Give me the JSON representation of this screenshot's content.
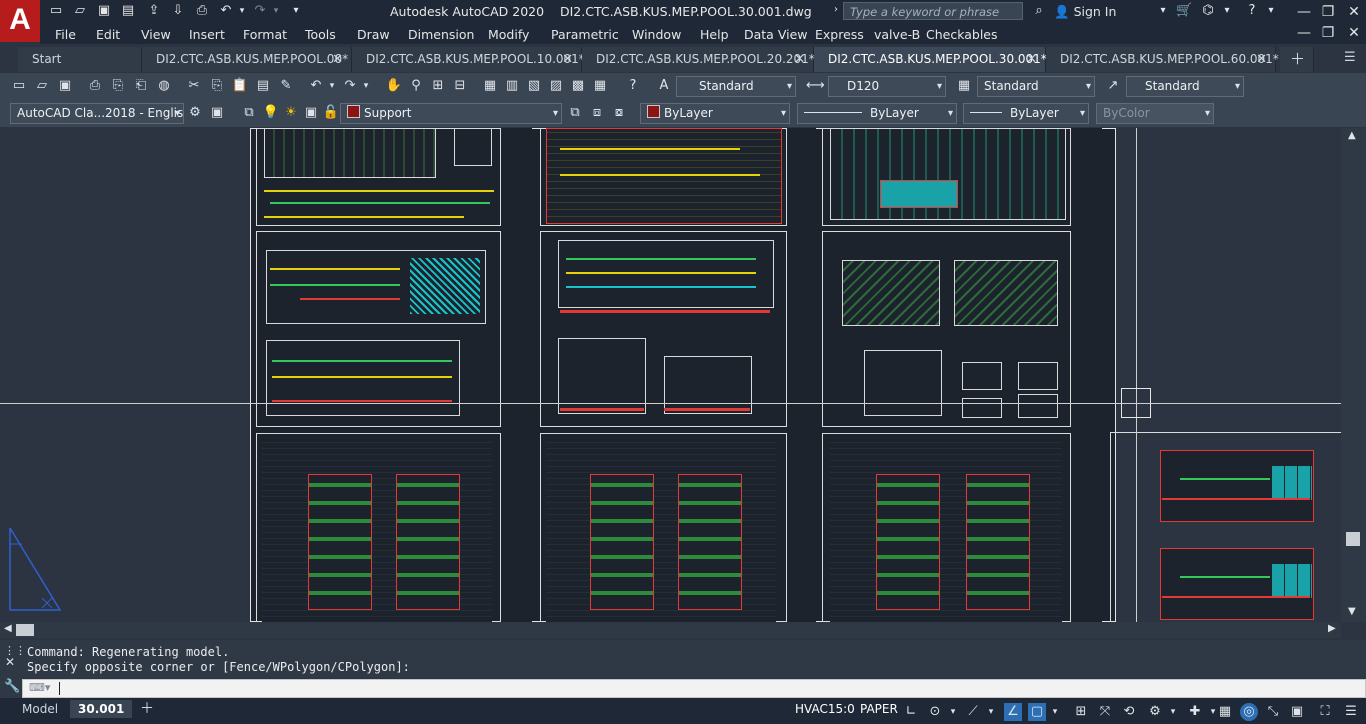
{
  "app": {
    "logo_letter": "A",
    "title": "Autodesk AutoCAD 2020",
    "filename": "DI2.CTC.ASB.KUS.MEP.POOL.30.001.dwg",
    "search_placeholder": "Type a keyword or phrase",
    "sign_in": "Sign In"
  },
  "menu": [
    "File",
    "Edit",
    "View",
    "Insert",
    "Format",
    "Tools",
    "Draw",
    "Dimension",
    "Modify",
    "Parametric",
    "Window",
    "Help",
    "Data View",
    "Express",
    "valve-B",
    "Checkables"
  ],
  "tabs": [
    {
      "label": "Start",
      "active": false
    },
    {
      "label": "DI2.CTC.ASB.KUS.MEP.POOL.00*",
      "active": false
    },
    {
      "label": "DI2.CTC.ASB.KUS.MEP.POOL.10.001*",
      "active": false
    },
    {
      "label": "DI2.CTC.ASB.KUS.MEP.POOL.20.201*",
      "active": false
    },
    {
      "label": "DI2.CTC.ASB.KUS.MEP.POOL.30.001*",
      "active": true
    },
    {
      "label": "DI2.CTC.ASB.KUS.MEP.POOL.60.001*",
      "active": false
    }
  ],
  "toolbar1": {
    "text_style": "Standard",
    "dim_style": "D120",
    "table_style": "Standard",
    "multileader_style": "Standard"
  },
  "toolbar2": {
    "workspace": "AutoCAD Cla...2018 - Englisl",
    "layer": "Support",
    "color": "ByLayer",
    "linetype": "ByLayer",
    "lineweight": "ByLayer",
    "plot_style": "ByColor"
  },
  "command": {
    "line1": "Command: Regenerating model.",
    "line2": "Specify opposite corner or [Fence/WPolygon/CPolygon]:"
  },
  "status": {
    "model_tab": "Model",
    "layout_tab": "30.001",
    "viewport": "HVAC15:0",
    "space": "PAPER"
  },
  "colors": {
    "background": "#2b3440",
    "sheet": "#1d232c",
    "accent_red": "#b71c1c",
    "yellow": "#e6d20a",
    "green": "#34c759",
    "cyan": "#19c3c9"
  }
}
